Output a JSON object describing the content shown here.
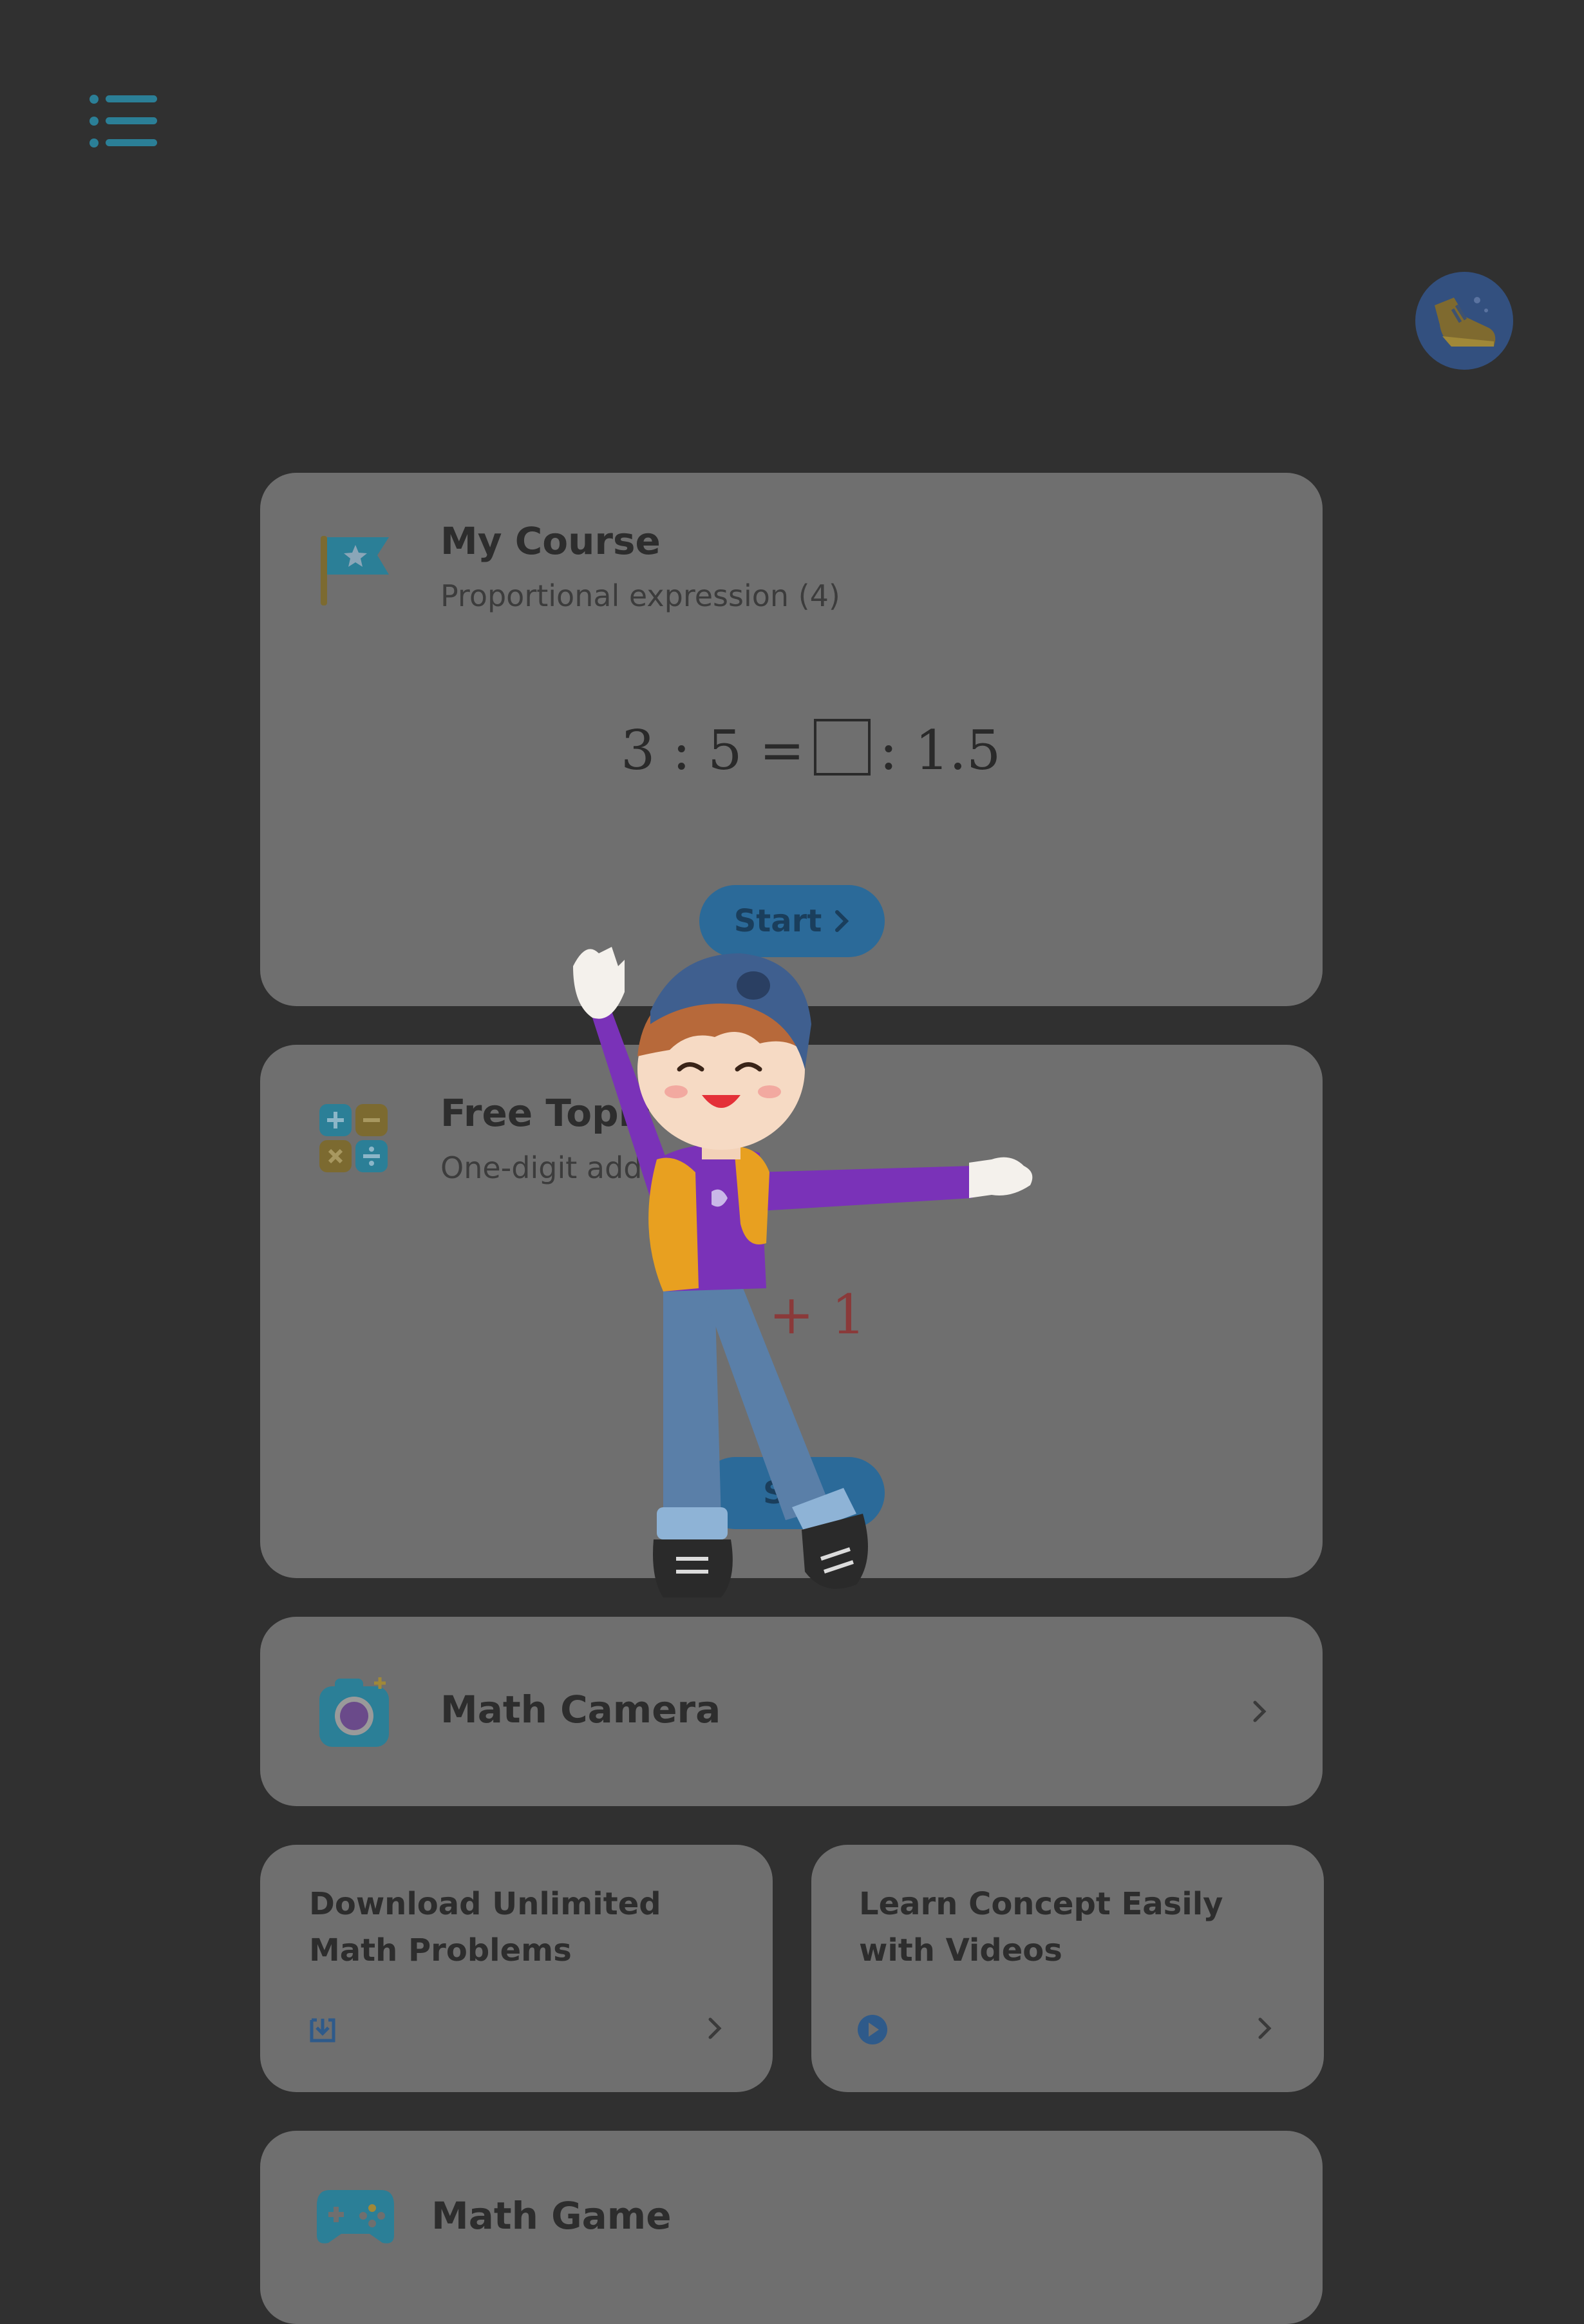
{
  "colors": {
    "background": "#303030",
    "card": "#6f6f6f",
    "accent_teal": "#2b7f97",
    "start_button": "#2b6a99",
    "equation_red": "#8a3a3a"
  },
  "header": {
    "menu_icon": "list-icon",
    "avatar_icon": "sneaker-icon"
  },
  "my_course": {
    "icon": "flag-icon",
    "title": "My Course",
    "subtitle": "Proportional expression (4)",
    "equation_left": "3 : 5 =",
    "equation_right": ": 1.5",
    "start_label": "Start"
  },
  "free_topic": {
    "icon": "calculator-operations-icon",
    "title": "Free Topic",
    "subtitle": "One-digit additi",
    "equation_visible": "+ 1",
    "start_label": "Sta"
  },
  "math_camera": {
    "icon": "camera-icon",
    "title": "Math Camera"
  },
  "download": {
    "title": "Download Unlimited Math Problems",
    "icon": "download-icon"
  },
  "videos": {
    "title": "Learn Concept Easily with Videos",
    "icon": "play-icon"
  },
  "math_game": {
    "icon": "gamepad-icon",
    "title": "Math Game"
  },
  "overlay": {
    "character": "cheering-boy-character"
  }
}
